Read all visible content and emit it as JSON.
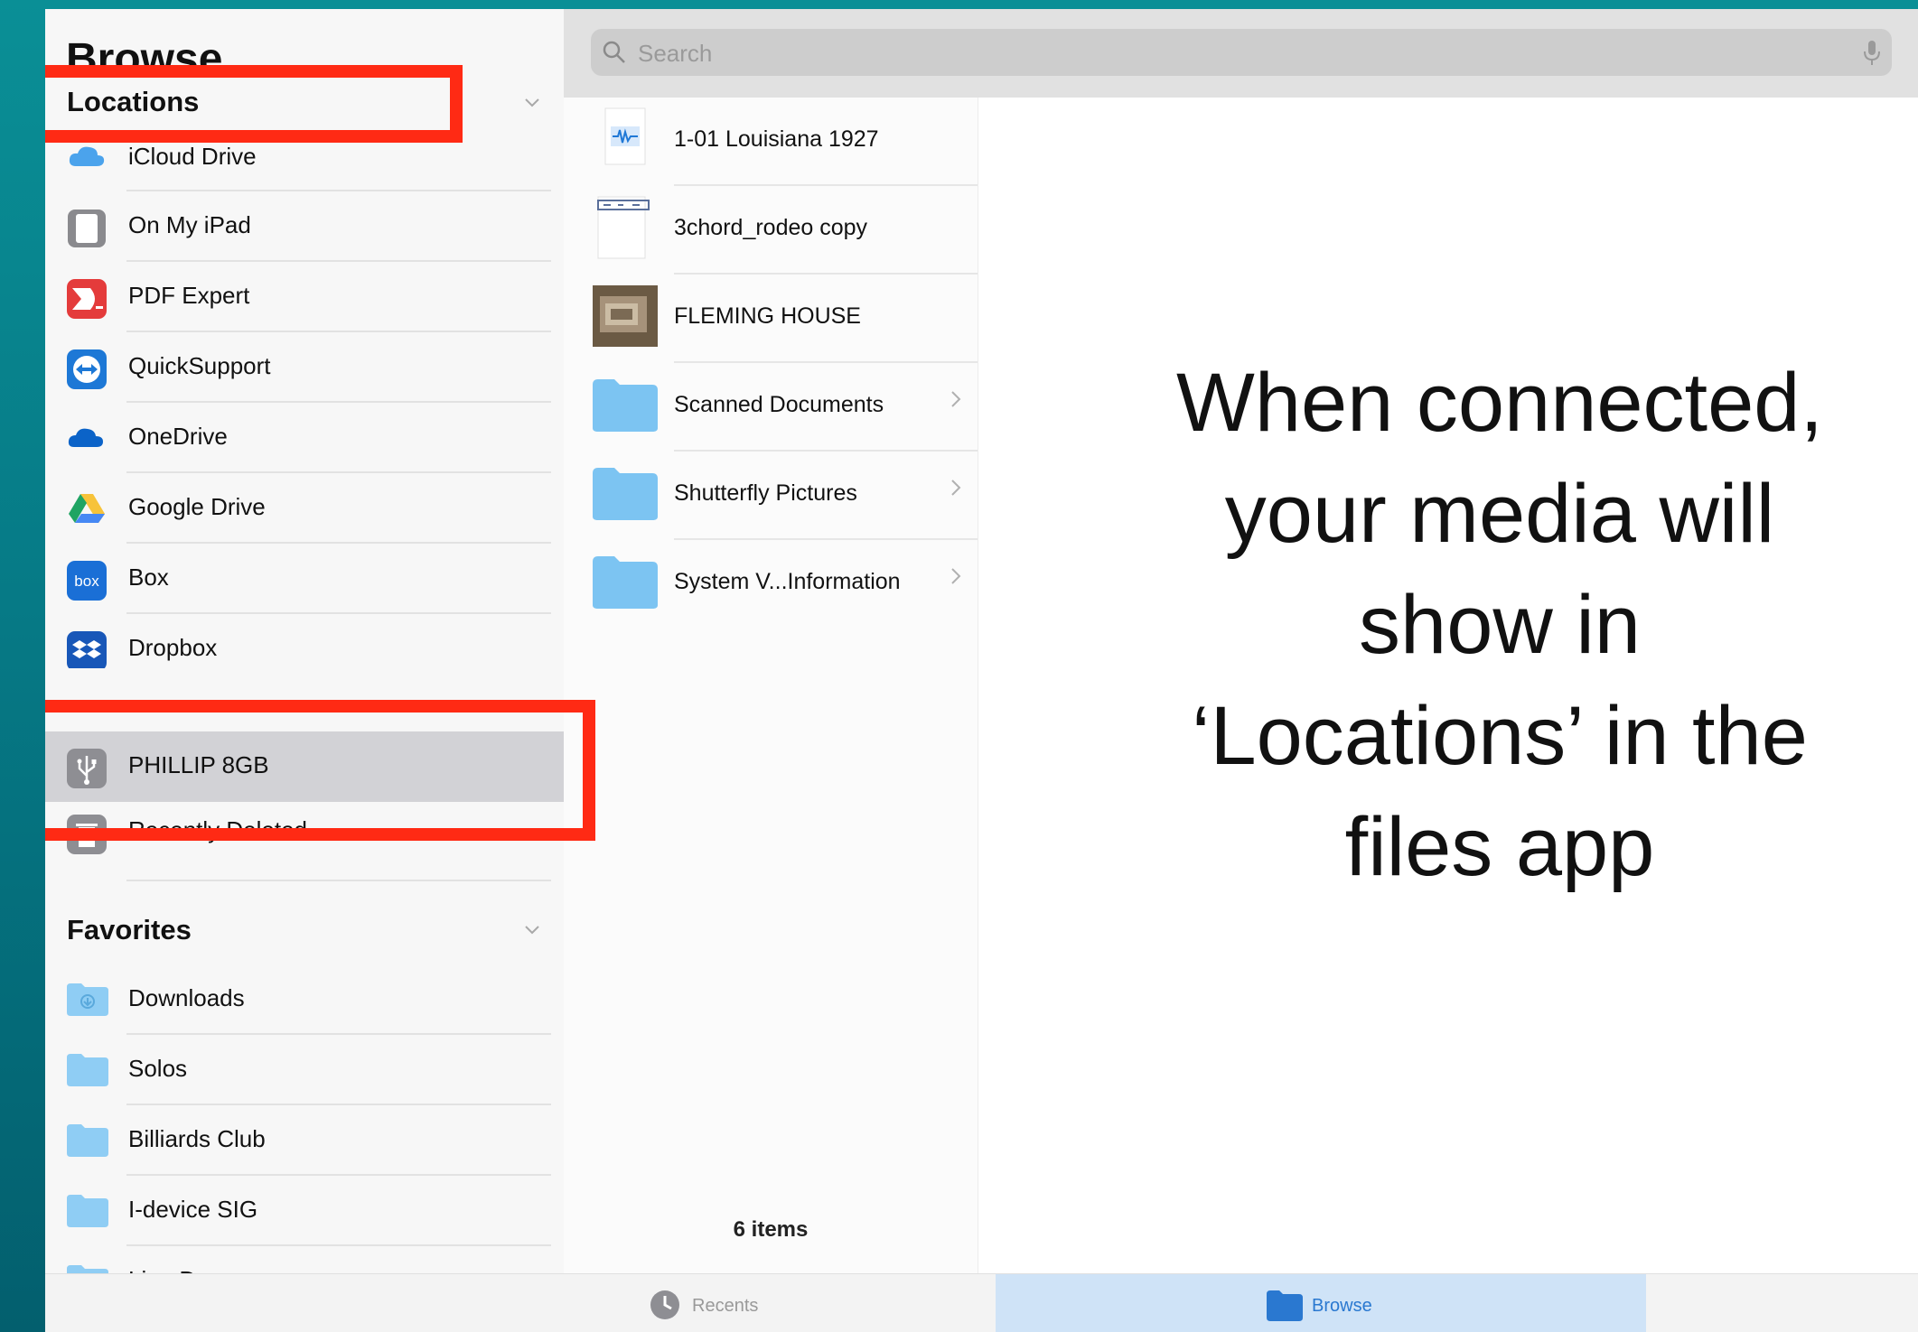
{
  "sidebar": {
    "title": "Browse",
    "locations_header": "Locations",
    "favorites_header": "Favorites",
    "locations": [
      {
        "label": "iCloud Drive",
        "icon": "icloud-icon"
      },
      {
        "label": "On My iPad",
        "icon": "ipad-icon"
      },
      {
        "label": "PDF Expert",
        "icon": "pdf-expert-icon"
      },
      {
        "label": "QuickSupport",
        "icon": "quicksupport-icon"
      },
      {
        "label": "OneDrive",
        "icon": "onedrive-icon"
      },
      {
        "label": "Google Drive",
        "icon": "google-drive-icon"
      },
      {
        "label": "Box",
        "icon": "box-icon"
      },
      {
        "label": "Dropbox",
        "icon": "dropbox-icon"
      },
      {
        "label": "PHILLIP 8GB",
        "icon": "usb-drive-icon",
        "selected": true
      },
      {
        "label": "Recently Deleted",
        "icon": "trash-icon"
      }
    ],
    "favorites": [
      {
        "label": "Downloads",
        "icon": "downloads-folder-icon"
      },
      {
        "label": "Solos",
        "icon": "folder-icon"
      },
      {
        "label": "Billiards Club",
        "icon": "folder-icon"
      },
      {
        "label": "I-device SIG",
        "icon": "folder-icon"
      },
      {
        "label": "Line Dance",
        "icon": "folder-icon"
      }
    ]
  },
  "search": {
    "placeholder": "Search"
  },
  "files": {
    "items": [
      {
        "name": "1-01 Louisiana 1927",
        "type": "audio"
      },
      {
        "name": "3chord_rodeo copy",
        "type": "document"
      },
      {
        "name": "FLEMING HOUSE",
        "type": "image"
      },
      {
        "name": "Scanned Documents",
        "type": "folder"
      },
      {
        "name": "Shutterfly Pictures",
        "type": "folder"
      },
      {
        "name": "System V...Information",
        "type": "folder"
      }
    ],
    "count_label": "6 items"
  },
  "caption": {
    "line1": "When connected,",
    "line2": "your media will",
    "line3": "show in",
    "line4": "‘Locations’ in the",
    "line5": "files app"
  },
  "tabbar": {
    "recents_label": "Recents",
    "browse_label": "Browse"
  },
  "colors": {
    "highlight": "#ff2a14",
    "accent": "#2a78d0",
    "folder": "#7cc4f2"
  }
}
